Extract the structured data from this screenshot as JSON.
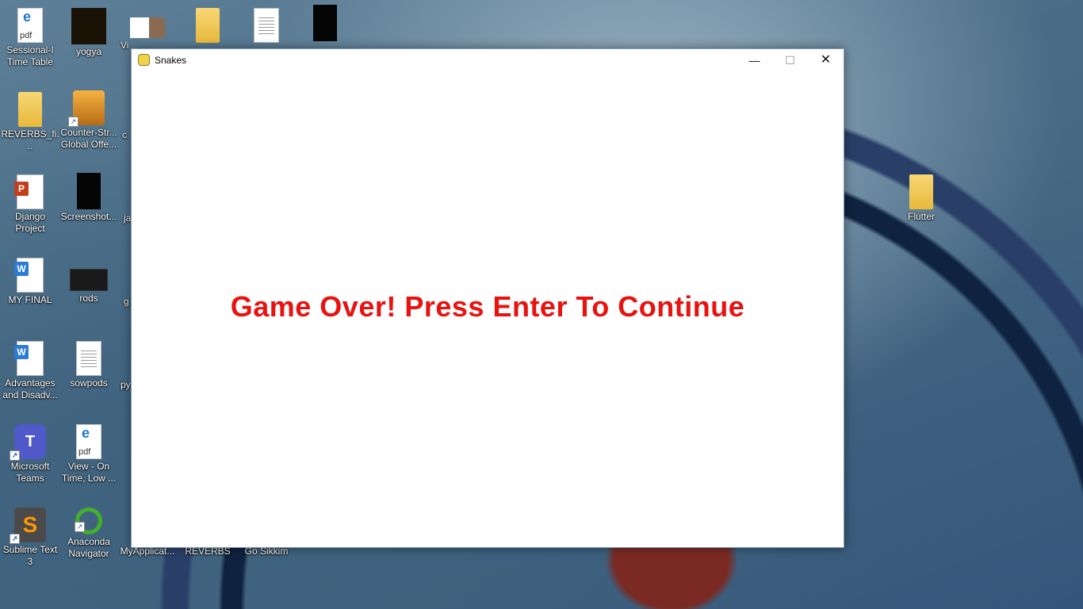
{
  "desktop_icons": [
    {
      "label": "Sessional-I Time Table",
      "icon": "pdf-icon"
    },
    {
      "label": "yogya",
      "icon": "image-icon"
    },
    {
      "label": "Vi",
      "icon": "photo-icon"
    },
    {
      "label": "",
      "icon": "folder-icon"
    },
    {
      "label": "",
      "icon": "text-document-icon"
    },
    {
      "label": "",
      "icon": "image-icon"
    },
    {
      "label": "REVERBS_fi...",
      "icon": "folder-icon"
    },
    {
      "label": "Counter-Str... Global Offe...",
      "icon": "counter-strike-icon"
    },
    {
      "label": "c",
      "icon": "partial-icon"
    },
    {
      "label": "Django Project",
      "icon": "powerpoint-icon"
    },
    {
      "label": "Screenshot...",
      "icon": "image-icon"
    },
    {
      "label": "ja",
      "icon": "partial-icon"
    },
    {
      "label": "MY FINAL",
      "icon": "word-icon"
    },
    {
      "label": "rods",
      "icon": "image-icon"
    },
    {
      "label": "g",
      "icon": "partial-icon"
    },
    {
      "label": "Advantages and Disadv...",
      "icon": "word-icon"
    },
    {
      "label": "sowpods",
      "icon": "text-document-icon"
    },
    {
      "label": "py",
      "icon": "partial-icon"
    },
    {
      "label": "Microsoft Teams",
      "icon": "teams-icon"
    },
    {
      "label": "View - On Time, Low ...",
      "icon": "pdf-icon"
    },
    {
      "label": "Sublime Text 3",
      "icon": "sublime-text-icon"
    },
    {
      "label": "Anaconda Navigator",
      "icon": "anaconda-icon"
    },
    {
      "label": "MyApplicat...",
      "icon": "partial-icon"
    },
    {
      "label": "REVERBS",
      "icon": "partial-icon"
    },
    {
      "label": "Go Sikkim",
      "icon": "partial-icon"
    },
    {
      "label": "Flutter",
      "icon": "folder-icon"
    }
  ],
  "window": {
    "title": "Snakes",
    "app_icon": "pygame-icon",
    "controls": {
      "minimize": "—",
      "maximize": "☐",
      "close": "✕"
    }
  },
  "game": {
    "message": "Game Over! Press Enter To Continue",
    "message_color": "#e8120f",
    "background_color": "#ffffff"
  }
}
